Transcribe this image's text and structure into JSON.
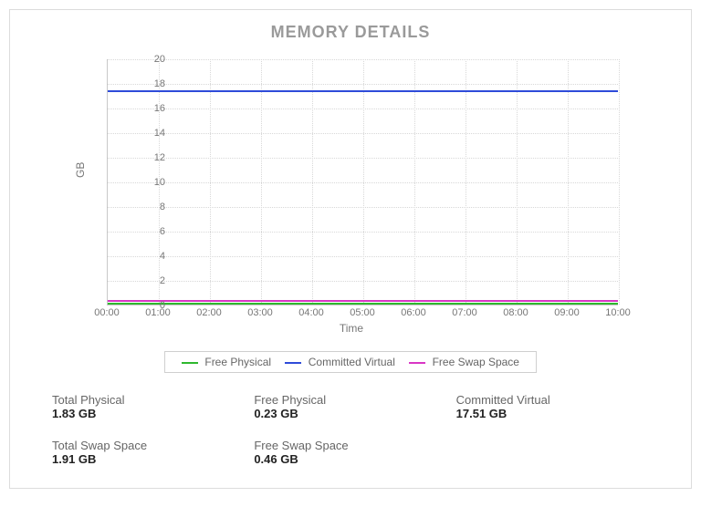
{
  "title": "MEMORY DETAILS",
  "ylabel": "GB",
  "xlabel": "Time",
  "legend": {
    "free_physical": "Free Physical",
    "committed_virtual": "Committed Virtual",
    "free_swap": "Free Swap Space"
  },
  "colors": {
    "free_physical": "#2eb82e",
    "committed_virtual": "#2e4bd9",
    "free_swap": "#d936c5"
  },
  "y_ticks": [
    "0",
    "2",
    "4",
    "6",
    "8",
    "10",
    "12",
    "14",
    "16",
    "18",
    "20"
  ],
  "x_ticks": [
    "00:00",
    "01:00",
    "02:00",
    "03:00",
    "04:00",
    "05:00",
    "06:00",
    "07:00",
    "08:00",
    "09:00",
    "10:00"
  ],
  "stats": {
    "total_physical": {
      "label": "Total Physical",
      "value": "1.83 GB"
    },
    "free_physical": {
      "label": "Free Physical",
      "value": "0.23 GB"
    },
    "committed_virtual": {
      "label": "Committed Virtual",
      "value": "17.51 GB"
    },
    "total_swap": {
      "label": "Total Swap Space",
      "value": "1.91 GB"
    },
    "free_swap": {
      "label": "Free Swap Space",
      "value": "0.46 GB"
    }
  },
  "chart_data": {
    "type": "line",
    "title": "MEMORY DETAILS",
    "xlabel": "Time",
    "ylabel": "GB",
    "ylim": [
      0,
      20
    ],
    "categories": [
      "00:00",
      "01:00",
      "02:00",
      "03:00",
      "04:00",
      "05:00",
      "06:00",
      "07:00",
      "08:00",
      "09:00",
      "10:00"
    ],
    "series": [
      {
        "name": "Free Physical",
        "color": "#2eb82e",
        "values": [
          0.23,
          0.23,
          0.23,
          0.23,
          0.23,
          0.23,
          0.23,
          0.23,
          0.3,
          0.23,
          0.23
        ]
      },
      {
        "name": "Committed Virtual",
        "color": "#2e4bd9",
        "values": [
          17.5,
          17.5,
          17.5,
          17.5,
          17.5,
          17.5,
          17.5,
          17.5,
          17.5,
          17.5,
          17.5
        ]
      },
      {
        "name": "Free Swap Space",
        "color": "#d936c5",
        "values": [
          0.46,
          0.46,
          0.46,
          0.46,
          0.46,
          0.5,
          0.46,
          0.46,
          0.46,
          0.46,
          0.46
        ]
      }
    ],
    "legend_position": "bottom",
    "grid": true
  }
}
